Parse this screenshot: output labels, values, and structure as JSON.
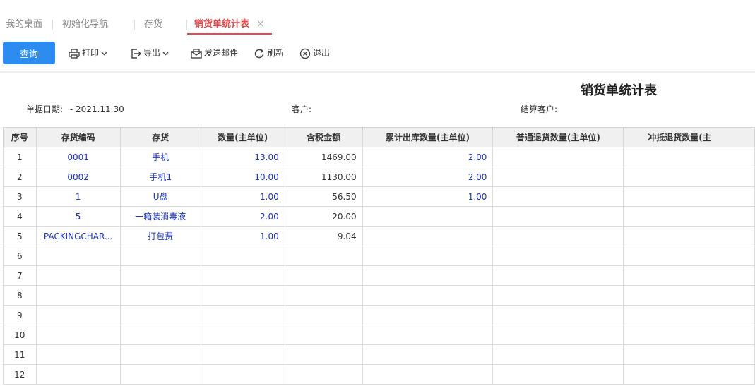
{
  "tabs": [
    {
      "label": "我的桌面"
    },
    {
      "label": "初始化导航"
    },
    {
      "label": "存货"
    },
    {
      "label": "销货单统计表",
      "close": "×"
    }
  ],
  "toolbar": {
    "query": "查询",
    "print": "打印",
    "export": "导出",
    "email": "发送邮件",
    "refresh": "刷新",
    "exit": "退出"
  },
  "report": {
    "title": "销货单统计表",
    "date_label": "单据日期:",
    "date_value": "- 2021.11.30",
    "customer_label": "客户:",
    "settle_customer_label": "结算客户:"
  },
  "table": {
    "columns": [
      "序号",
      "存货编码",
      "存货",
      "数量(主单位)",
      "含税金额",
      "累计出库数量(主单位)",
      "普通退货数量(主单位)",
      "冲抵退货数量(主"
    ],
    "rows": [
      [
        "1",
        "0001",
        "手机",
        "13.00",
        "1469.00",
        "2.00",
        "",
        ""
      ],
      [
        "2",
        "0002",
        "手机1",
        "10.00",
        "1130.00",
        "2.00",
        "",
        ""
      ],
      [
        "3",
        "1",
        "U盘",
        "1.00",
        "56.50",
        "1.00",
        "",
        ""
      ],
      [
        "4",
        "5",
        "一箱装消毒液",
        "2.00",
        "20.00",
        "",
        "",
        ""
      ],
      [
        "5",
        "PACKINGCHAR...",
        "打包费",
        "1.00",
        "9.04",
        "",
        "",
        ""
      ],
      [
        "6",
        "",
        "",
        "",
        "",
        "",
        "",
        ""
      ],
      [
        "7",
        "",
        "",
        "",
        "",
        "",
        "",
        ""
      ],
      [
        "8",
        "",
        "",
        "",
        "",
        "",
        "",
        ""
      ],
      [
        "9",
        "",
        "",
        "",
        "",
        "",
        "",
        ""
      ],
      [
        "10",
        "",
        "",
        "",
        "",
        "",
        "",
        ""
      ],
      [
        "11",
        "",
        "",
        "",
        "",
        "",
        "",
        ""
      ],
      [
        "12",
        "",
        "",
        "",
        "",
        "",
        "",
        ""
      ]
    ]
  },
  "colors": {
    "accent_tab": "#e8474b",
    "primary_button": "#2d8cf0",
    "link_text": "#1a33c7",
    "header_bg": "#f0f0f0"
  }
}
